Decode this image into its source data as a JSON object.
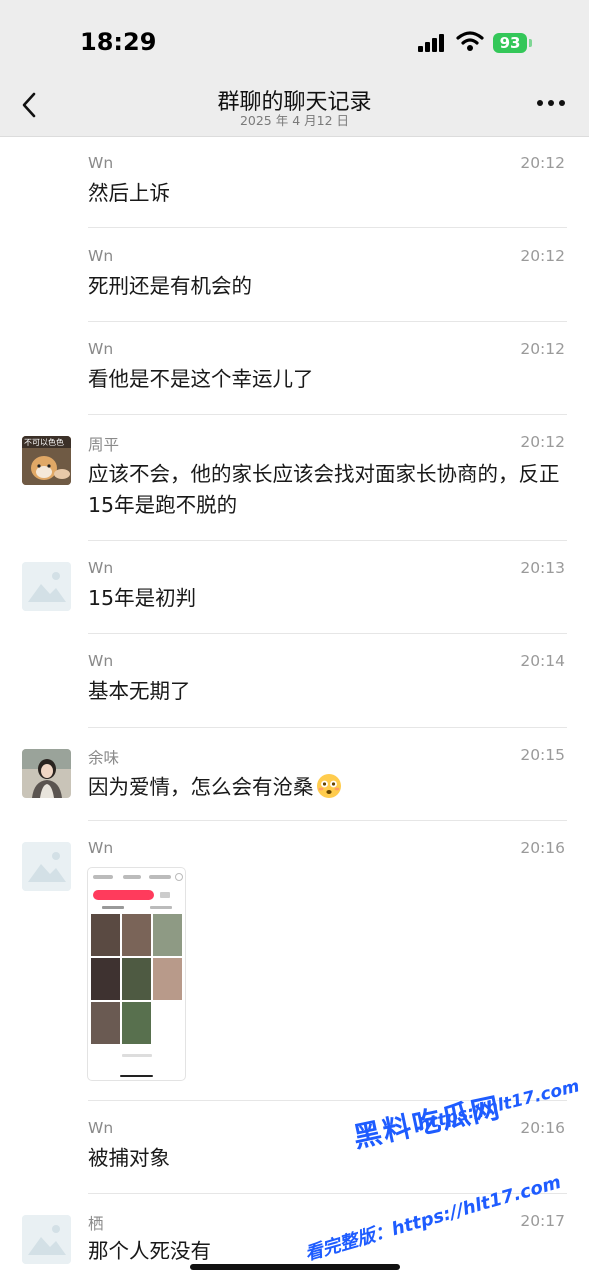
{
  "status": {
    "time": "18:29",
    "battery": "93"
  },
  "header": {
    "title": "群聊的聊天记录",
    "date": "2025 年 4 月12 日"
  },
  "messages": [
    {
      "name": "Wn",
      "time": "20:12",
      "text": "然后上诉"
    },
    {
      "name": "Wn",
      "time": "20:12",
      "text": "死刑还是有机会的"
    },
    {
      "name": "Wn",
      "time": "20:12",
      "text": "看他是不是这个幸运儿了"
    },
    {
      "name": "周平",
      "time": "20:12",
      "text": "应该不会，他的家长应该会找对面家长协商的，反正15年是跑不脱的",
      "avatar_text": "不可以色色"
    },
    {
      "name": "Wn",
      "time": "20:13",
      "text": "15年是初判"
    },
    {
      "name": "Wn",
      "time": "20:14",
      "text": "基本无期了"
    },
    {
      "name": "余味",
      "time": "20:15",
      "text": "因为爱情，怎么会有沧桑",
      "emoji": "flushed-face"
    },
    {
      "name": "Wn",
      "time": "20:16",
      "attachment": "image"
    },
    {
      "name": "Wn",
      "time": "20:16",
      "text": "被捕对象"
    },
    {
      "name": "栖",
      "time": "20:17",
      "text": "那个人死没有"
    }
  ],
  "watermark": {
    "line1": "黑料吃瓜网",
    "url": "https://hlt17.com",
    "line2": "看完整版：https://hlt17.com"
  },
  "colors": {
    "accent": "#34c759",
    "header_bg": "#ededed",
    "watermark": "#1e5cff",
    "pill": "#ff3b5c"
  }
}
